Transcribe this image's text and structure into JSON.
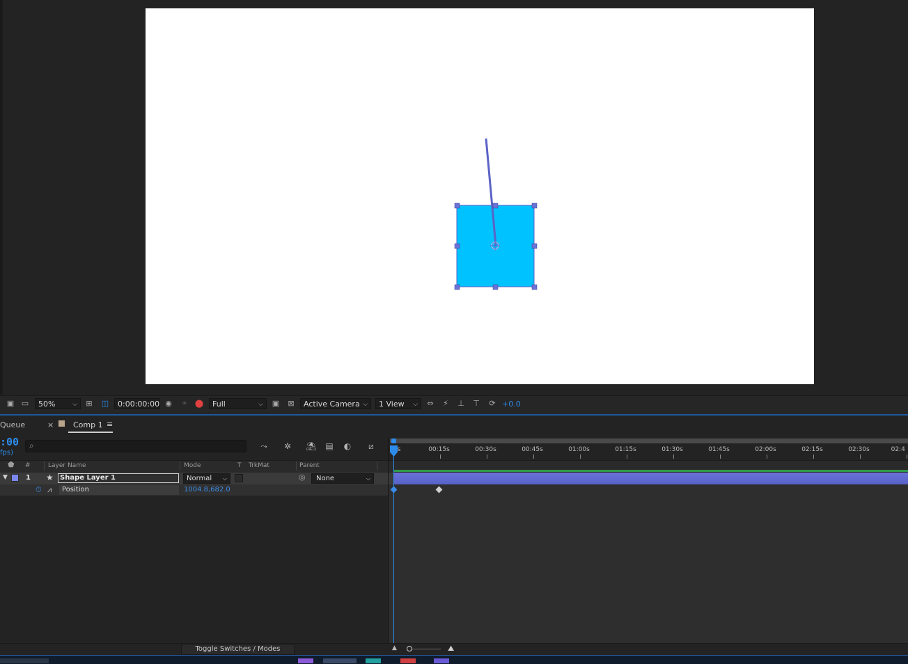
{
  "viewer": {
    "zoom": "50%",
    "current_time": "0:00:00:00",
    "resolution": "Full",
    "camera": "Active Camera",
    "views": "1 View",
    "exposure": "+0.0",
    "shape_color": "#00c2ff",
    "selection_color": "#6a73d8"
  },
  "timeline": {
    "tabs": {
      "queue_label": "Queue",
      "close_label": "×",
      "comp_label": "Comp 1",
      "menu_label": "≡"
    },
    "timecode": ":00",
    "fps_label": "fps)",
    "columns": {
      "label": "#",
      "layer_name": "Layer Name",
      "mode": "Mode",
      "t": "T",
      "trkmat": "TrkMat",
      "parent": "Parent"
    },
    "layer": {
      "number": "1",
      "name": "Shape Layer 1",
      "mode": "Normal",
      "parent": "None",
      "label_color": "#7c86f0"
    },
    "property": {
      "name": "Position",
      "value": "1004.8,682.0"
    },
    "ruler_labels": [
      "0s",
      "00:15s",
      "00:30s",
      "00:45s",
      "01:00s",
      "01:15s",
      "01:30s",
      "01:45s",
      "02:00s",
      "02:15s",
      "02:30s",
      "02:4"
    ],
    "toggle_label": "Toggle Switches / Modes",
    "accent_color": "#2d8ceb"
  }
}
